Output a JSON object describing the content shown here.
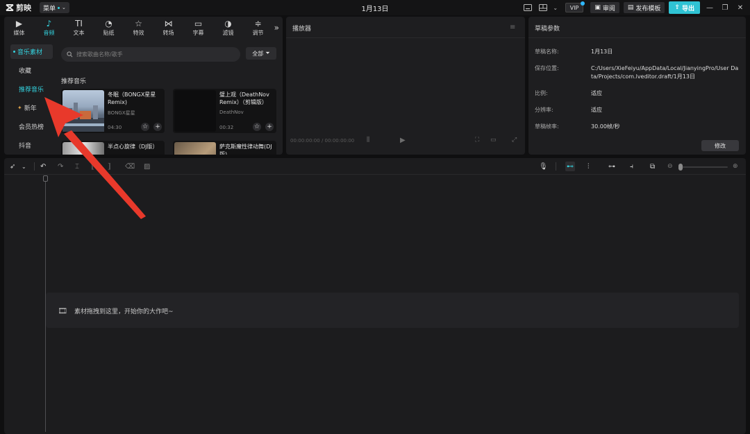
{
  "app": {
    "name": "剪映",
    "menu_label": "菜单",
    "project_title": "1月13日"
  },
  "titlebar": {
    "vip_label": "VIP",
    "review_label": "审阅",
    "publish_label": "发布模板",
    "export_label": "导出"
  },
  "media_tabs": [
    {
      "label": "媒体",
      "icon": "media-icon",
      "glyph": "▶"
    },
    {
      "label": "音频",
      "icon": "audio-icon",
      "glyph": "♪"
    },
    {
      "label": "文本",
      "icon": "text-icon",
      "glyph": "TI"
    },
    {
      "label": "贴纸",
      "icon": "sticker-icon",
      "glyph": "◔"
    },
    {
      "label": "特效",
      "icon": "effect-icon",
      "glyph": "☆"
    },
    {
      "label": "转场",
      "icon": "transition-icon",
      "glyph": "⋈"
    },
    {
      "label": "字幕",
      "icon": "caption-icon",
      "glyph": "▭"
    },
    {
      "label": "滤镜",
      "icon": "filter-icon",
      "glyph": "◑"
    },
    {
      "label": "调节",
      "icon": "adjust-icon",
      "glyph": "≑"
    }
  ],
  "sidebar": {
    "header": "音乐素材",
    "items": [
      "收藏",
      "推荐音乐",
      "新年",
      "会员热榜",
      "抖音"
    ]
  },
  "search": {
    "placeholder": "搜索歌曲名称/歌手"
  },
  "filter": {
    "label": "全部"
  },
  "music_section": {
    "title": "推荐音乐",
    "tracks": [
      {
        "name": "冬眠（BONGX星星Remix)",
        "artist": "BONGX星星",
        "duration": "04:30"
      },
      {
        "name": "璧上观（DeathNov Remix）（剪辑版）",
        "artist": "DeathNov",
        "duration": "00:32"
      },
      {
        "name": "半点心旋律（DJ版）",
        "artist": "",
        "duration": ""
      },
      {
        "name": "萨克斯魔性律动舞(DJ版)",
        "artist": "",
        "duration": ""
      }
    ]
  },
  "player": {
    "title": "播放器",
    "timecode_current": "00:00:00:00",
    "timecode_total": "00:00:00:00"
  },
  "params": {
    "title": "草稿参数",
    "rows": [
      {
        "label": "草稿名称:",
        "value": "1月13日"
      },
      {
        "label": "保存位置:",
        "value": "C:/Users/XieFeiyu/AppData/Local/JianyingPro/User Data/Projects/com.lveditor.draft/1月13日"
      },
      {
        "label": "比例:",
        "value": "适应"
      },
      {
        "label": "分辨率:",
        "value": "适应"
      },
      {
        "label": "草稿帧率:",
        "value": "30.00帧/秒"
      }
    ],
    "modify_label": "修改"
  },
  "timeline": {
    "drop_hint": "素材拖拽到这里，开始你的大作吧~"
  },
  "colors": {
    "accent": "#34d4e0",
    "annotation_arrow": "#e8392b"
  }
}
